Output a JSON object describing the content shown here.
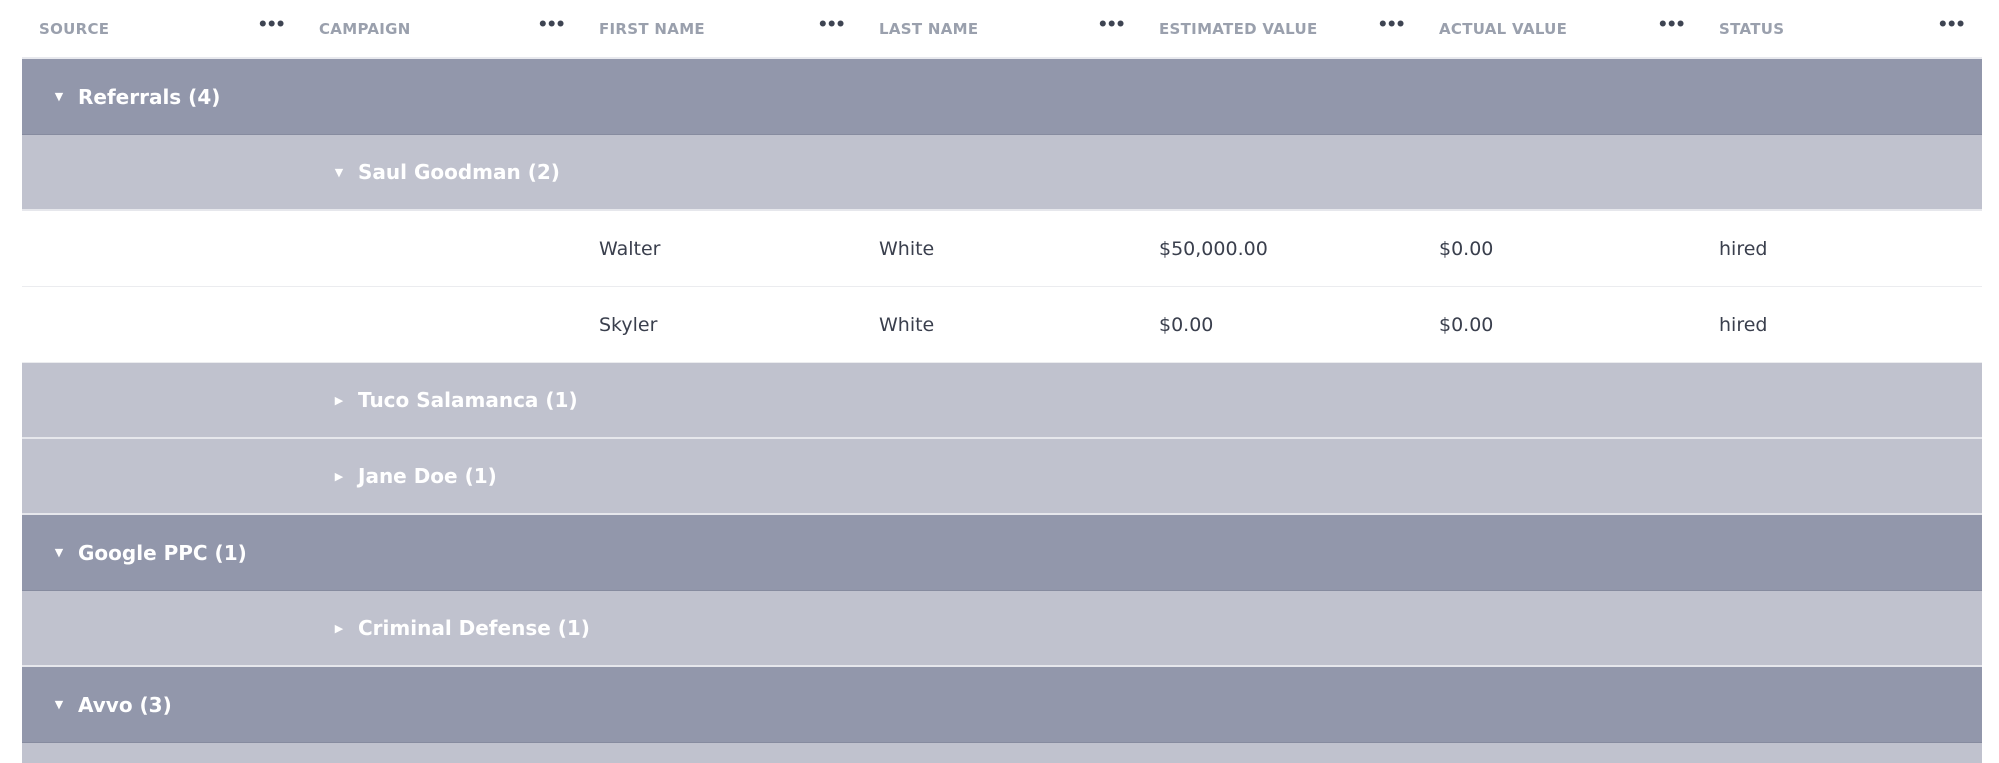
{
  "columns": [
    {
      "label": "SOURCE",
      "menu": "•••"
    },
    {
      "label": "CAMPAIGN",
      "menu": "•••"
    },
    {
      "label": "FIRST NAME",
      "menu": "•••"
    },
    {
      "label": "LAST NAME",
      "menu": "•••"
    },
    {
      "label": "ESTIMATED VALUE",
      "menu": "•••"
    },
    {
      "label": "ACTUAL VALUE",
      "menu": "•••"
    },
    {
      "label": "STATUS",
      "menu": "•••"
    }
  ],
  "icons": {
    "expanded": "caret-down-icon",
    "collapsed": "caret-right-icon"
  },
  "colors": {
    "group_level1": "#9297ab",
    "group_level2": "#c0c2ce",
    "header_text": "#9aa0ad",
    "body_text": "#3a3f4d"
  },
  "groups": {
    "referrals": {
      "label": "Referrals (4)",
      "caret": "▼"
    },
    "saul": {
      "label": "Saul Goodman (2)",
      "caret": "▼"
    },
    "tuco": {
      "label": "Tuco Salamanca (1)",
      "caret": "▶"
    },
    "jane": {
      "label": "Jane Doe (1)",
      "caret": "▶"
    },
    "google": {
      "label": "Google PPC (1)",
      "caret": "▼"
    },
    "criminal": {
      "label": "Criminal Defense (1)",
      "caret": "▶"
    },
    "avvo": {
      "label": "Avvo (3)",
      "caret": "▼"
    }
  },
  "rows": [
    {
      "first": "Walter",
      "last": "White",
      "estimated": "$50,000.00",
      "actual": "$0.00",
      "status": "hired"
    },
    {
      "first": "Skyler",
      "last": "White",
      "estimated": "$0.00",
      "actual": "$0.00",
      "status": "hired"
    }
  ]
}
